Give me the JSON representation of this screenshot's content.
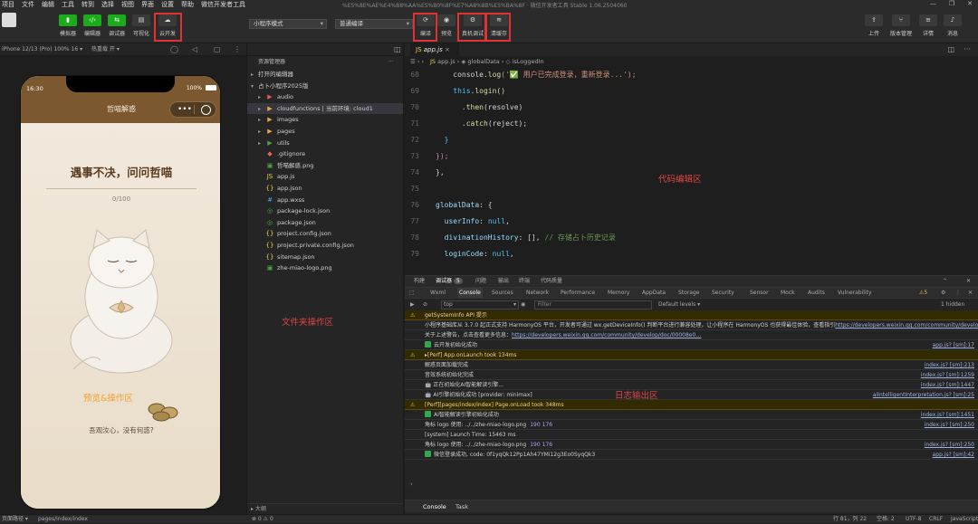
{
  "menu": [
    "项目",
    "文件",
    "编辑",
    "工具",
    "转到",
    "选择",
    "视图",
    "界面",
    "设置",
    "帮助",
    "微信开发者工具"
  ],
  "window_title": "%E5%8E%AE%E4%B8%AA%E5%B0%8F%E7%A8%8B%E5%BA%8F · 微信开发者工具 Stable 1.06.2504060",
  "toolbar": {
    "simulator": "模拟器",
    "editor": "编辑器",
    "debugger": "调试器",
    "visual": "可视化",
    "cloud": "云开发",
    "mode_select": "小程序模式",
    "compile_select": "普通编译",
    "compile": "编译",
    "preview": "预览",
    "remote_debug": "真机调试",
    "clear_cache": "清缓存",
    "upload": "上传",
    "version": "版本管理",
    "details": "详情",
    "messages": "消息"
  },
  "simulator": {
    "device": "iPhone 12/13 (Pro) 100% 16 ▾",
    "hot_reload": "热重载 开 ▾",
    "time": "16:30",
    "battery": "100%",
    "nav_title": "哲喵解惑",
    "capsule_dots": "•••",
    "heading": "遇事不决，问问哲喵",
    "counter": "0/100",
    "question": "吾观汝心，没有何惑?"
  },
  "annotations": {
    "preview": "预览&操作区",
    "folder": "文件夹操作区",
    "code": "代码编辑区",
    "log": "日志输出区"
  },
  "explorer": {
    "title": "资源管理器",
    "open_editors": "打开的编辑器",
    "project": "占卜小程序2025版",
    "items": [
      {
        "name": "audio",
        "icon": "▶",
        "color": "#e85a5a",
        "folder": true
      },
      {
        "name": "cloudfunctions | 当前环境: cloud1",
        "icon": "▶",
        "color": "#e0a84a",
        "folder": true,
        "selected": true
      },
      {
        "name": "images",
        "icon": "▶",
        "color": "#e0a84a",
        "folder": true
      },
      {
        "name": "pages",
        "icon": "▶",
        "color": "#e0a84a",
        "folder": true
      },
      {
        "name": "utils",
        "icon": "▶",
        "color": "#4ca54c",
        "folder": true
      },
      {
        "name": ".gitignore",
        "icon": "◆",
        "color": "#e06b4a",
        "folder": false
      },
      {
        "name": "哲喵解惑.png",
        "icon": "▣",
        "color": "#4ca54c",
        "folder": false
      },
      {
        "name": "app.js",
        "icon": "JS",
        "color": "#e8d44d",
        "folder": false
      },
      {
        "name": "app.json",
        "icon": "{}",
        "color": "#e8d44d",
        "folder": false
      },
      {
        "name": "app.wxss",
        "icon": "#",
        "color": "#4aa0e8",
        "folder": false
      },
      {
        "name": "package-lock.json",
        "icon": "◎",
        "color": "#4ca54c",
        "folder": false
      },
      {
        "name": "package.json",
        "icon": "◎",
        "color": "#4ca54c",
        "folder": false
      },
      {
        "name": "project.config.json",
        "icon": "{}",
        "color": "#e8d44d",
        "folder": false
      },
      {
        "name": "project.private.config.json",
        "icon": "{}",
        "color": "#e8d44d",
        "folder": false
      },
      {
        "name": "sitemap.json",
        "icon": "{}",
        "color": "#e8d44d",
        "folder": false
      },
      {
        "name": "zhe-miao-logo.png",
        "icon": "▣",
        "color": "#4ca54c",
        "folder": false
      }
    ],
    "outline": "大纲"
  },
  "editor": {
    "tab": "app.js",
    "crumbs": [
      "app.js",
      "globalData",
      "isLoggedIn"
    ],
    "lines": [
      {
        "n": "68",
        "html": "console_log"
      },
      {
        "n": "69",
        "html": "this_login"
      },
      {
        "n": "70",
        "html": "then"
      },
      {
        "n": "71",
        "html": "catch"
      },
      {
        "n": "72",
        "html": "close1"
      },
      {
        "n": "73",
        "html": "close2"
      },
      {
        "n": "74",
        "html": "close3"
      },
      {
        "n": "75",
        "html": "blank"
      },
      {
        "n": "76",
        "html": "globalData"
      },
      {
        "n": "77",
        "html": "userInfo"
      },
      {
        "n": "78",
        "html": "divination"
      },
      {
        "n": "79",
        "html": "loginCode"
      }
    ],
    "code": {
      "console_log_a": "console.",
      "console_log_b": "log",
      "console_log_c": "('✅ 用户已完成登录，重新登录...');",
      "this_login_a": "this",
      "this_login_b": ".login()",
      "then_a": ".",
      "then_b": "then",
      "then_c": "(resolve)",
      "catch_a": ".",
      "catch_b": "catch",
      "catch_c": "(reject);",
      "close1": "}",
      "close2": "});",
      "close3": "},",
      "gd_a": "globalData",
      "gd_b": ": {",
      "ui_a": "userInfo",
      "ui_b": ": ",
      "ui_c": "null",
      "ui_d": ",",
      "dh_a": "divinationHistory",
      "dh_b": ": [], ",
      "dh_c": "// 存储占卜历史记录",
      "lc_a": "loginCode",
      "lc_b": ": ",
      "lc_c": "null",
      "lc_d": ","
    }
  },
  "console": {
    "tabs_top": [
      "构建",
      "调试器",
      "问题",
      "输出",
      "终端",
      "代码质量"
    ],
    "debugger_badge": "5",
    "tabs": [
      "Wxml",
      "Console",
      "Sources",
      "Network",
      "Performance",
      "Memory",
      "AppData",
      "Storage",
      "Security",
      "Sensor",
      "Mock",
      "Audits",
      "Vulnerability"
    ],
    "warn_count": "5",
    "context": "top",
    "filter": "Filter",
    "levels": "Default levels ▾",
    "hidden": "1 hidden",
    "logs": [
      {
        "type": "warn",
        "text": "getSystemInfo API 提示",
        "src": ""
      },
      {
        "type": "plain",
        "text": "小程序基础库从 3.7.0 起正式支持 HarmonyOS 平台，开发者可通过 wx.getDeviceInfo() 判断平台进行兼容处理，让小程序在 HarmonyOS 也获得最佳体验，查看指引",
        "link": "https://developers.weixin.qq.com/community/develop/doc/00008e0…",
        "src": ""
      },
      {
        "type": "plain",
        "text": "关于上述警告，点击查看更多信息：",
        "link": "https://developers.weixin.qq.com/community/develop/doc/00008e0…",
        "src": ""
      },
      {
        "type": "ok",
        "text": "云开发初始化成功",
        "src": "app.js? [sm]:17"
      },
      {
        "type": "warn",
        "text": "▸[Perf] App.onLaunch took 134ms",
        "src": ""
      },
      {
        "type": "plain",
        "text": "解惑页面加载完成",
        "src": "index.js? [sm]:213"
      },
      {
        "type": "plain",
        "text": "音效系统初始化完成",
        "src": "index.js? [sm]:1259"
      },
      {
        "type": "plain",
        "text": "🤖 正在初始化AI智能解读引擎...",
        "src": "index.js? [sm]:1447"
      },
      {
        "type": "plain",
        "text": "🤖 AI引擎初始化成功 [provider: minimax]",
        "src": "aiIntelligentInterpretation.js? [sm]:25"
      },
      {
        "type": "warn",
        "text": "[Perf][pages/index/index] Page.onLoad took 348ms",
        "src": ""
      },
      {
        "type": "ok",
        "text": "AI智能解读引擎初始化成功",
        "src": "index.js? [sm]:1451"
      },
      {
        "type": "plain",
        "text": "角标 logo 使用: ../../zhe-miao-logo.png",
        "nums": "190 176",
        "src": "index.js? [sm]:250"
      },
      {
        "type": "plain",
        "text": "[system] Launch Time: 15463 ms",
        "src": ""
      },
      {
        "type": "plain",
        "text": "角标 logo 使用: ../../zhe-miao-logo.png",
        "nums": "190 176",
        "src": "index.js? [sm]:250"
      },
      {
        "type": "ok",
        "text": "微信登录成功, code: 0f1yqQk12Pp1Ah47YMi12g3Eo0SyqQk3",
        "src": "app.js? [sm]:42"
      }
    ],
    "bottom_tabs": [
      "Console",
      "Task"
    ]
  },
  "statusbar": {
    "path_label": "页面路径 ▾",
    "path": "pages/index/index",
    "errors": "⊗ 0 ⚠ 0",
    "position": "行 81，列 22",
    "spaces": "空格: 2",
    "encoding": "UTF-8",
    "eol": "CRLF",
    "lang": "JavaScript"
  }
}
